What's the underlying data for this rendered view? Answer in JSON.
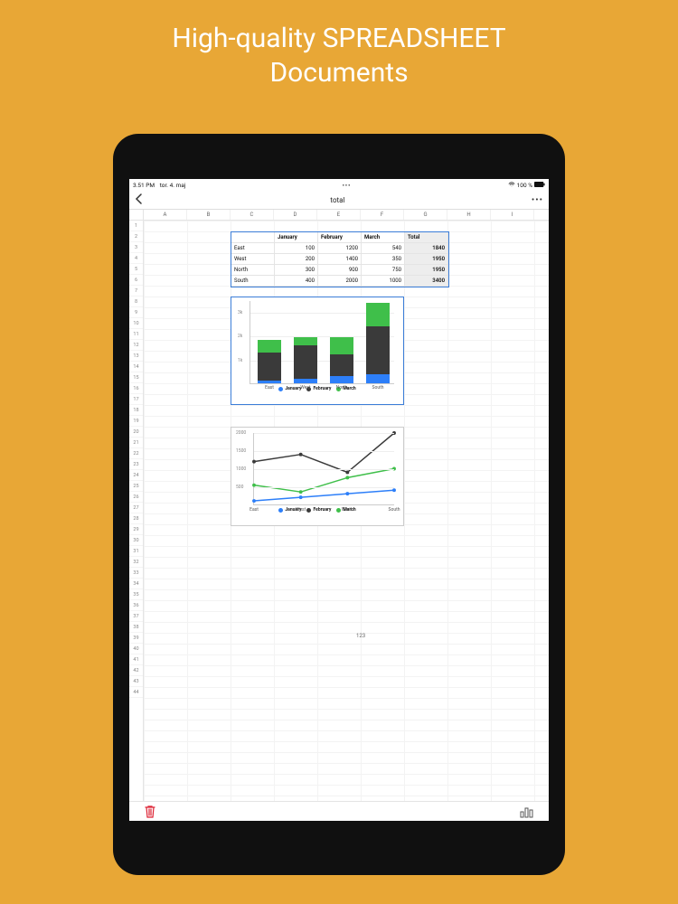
{
  "promo": {
    "line1": "High-quality SPREADSHEET",
    "line2": "Documents"
  },
  "status": {
    "time": "3.51 PM",
    "date": "tor. 4. maj",
    "wifi": "wifi-icon",
    "battery_pct": "100 %"
  },
  "header": {
    "title": "total"
  },
  "columns": [
    "A",
    "B",
    "C",
    "D",
    "E",
    "F",
    "G",
    "H",
    "I"
  ],
  "row_count": 44,
  "table": {
    "col_headers": [
      "",
      "January",
      "February",
      "March",
      "Total"
    ],
    "rows": [
      {
        "label": "East",
        "jan": 100,
        "feb": 1200,
        "mar": 540,
        "total": 1840
      },
      {
        "label": "West",
        "jan": 200,
        "feb": 1400,
        "mar": 350,
        "total": 1950
      },
      {
        "label": "North",
        "jan": 300,
        "feb": 900,
        "mar": 750,
        "total": 1950
      },
      {
        "label": "South",
        "jan": 400,
        "feb": 2000,
        "mar": 1000,
        "total": 3400
      }
    ]
  },
  "floating_text": {
    "value": "123"
  },
  "chart_data": [
    {
      "type": "bar",
      "stacked": true,
      "categories": [
        "East",
        "West",
        "North",
        "South"
      ],
      "series": [
        {
          "name": "January",
          "color": "#2d7ff9",
          "values": [
            100,
            200,
            300,
            400
          ]
        },
        {
          "name": "February",
          "color": "#3a3a3a",
          "values": [
            1200,
            1400,
            900,
            2000
          ]
        },
        {
          "name": "March",
          "color": "#3fbf4a",
          "values": [
            540,
            350,
            750,
            1000
          ]
        }
      ],
      "ylim": [
        0,
        3500
      ],
      "yticks": [
        "1k",
        "2k",
        "3k"
      ],
      "legend_pos": "bottom"
    },
    {
      "type": "line",
      "categories": [
        "East",
        "West",
        "North",
        "South"
      ],
      "series": [
        {
          "name": "January",
          "color": "#2d7ff9",
          "values": [
            100,
            200,
            300,
            400
          ]
        },
        {
          "name": "February",
          "color": "#3a3a3a",
          "values": [
            1200,
            1400,
            900,
            2000
          ]
        },
        {
          "name": "March",
          "color": "#3fbf4a",
          "values": [
            540,
            350,
            750,
            1000
          ]
        }
      ],
      "ylim": [
        0,
        2000
      ],
      "yticks": [
        500,
        1000,
        1500,
        2000
      ],
      "legend_pos": "bottom"
    }
  ],
  "icons": {
    "trash": "trash-icon",
    "chart": "chart-icon"
  }
}
